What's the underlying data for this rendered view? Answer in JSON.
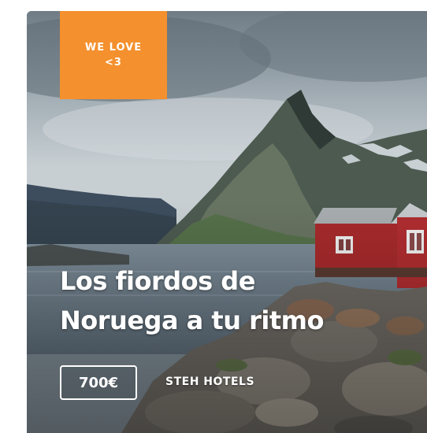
{
  "card": {
    "badge": {
      "line1": "WE LOVE",
      "line2": "<3"
    },
    "title_line1": "Los fiordos de",
    "title_line2": "Noruega a tu ritmo",
    "price": "700€",
    "brand": "STEH HOTELS"
  },
  "colors": {
    "badge": "#f4902e",
    "text": "#ffffff"
  }
}
